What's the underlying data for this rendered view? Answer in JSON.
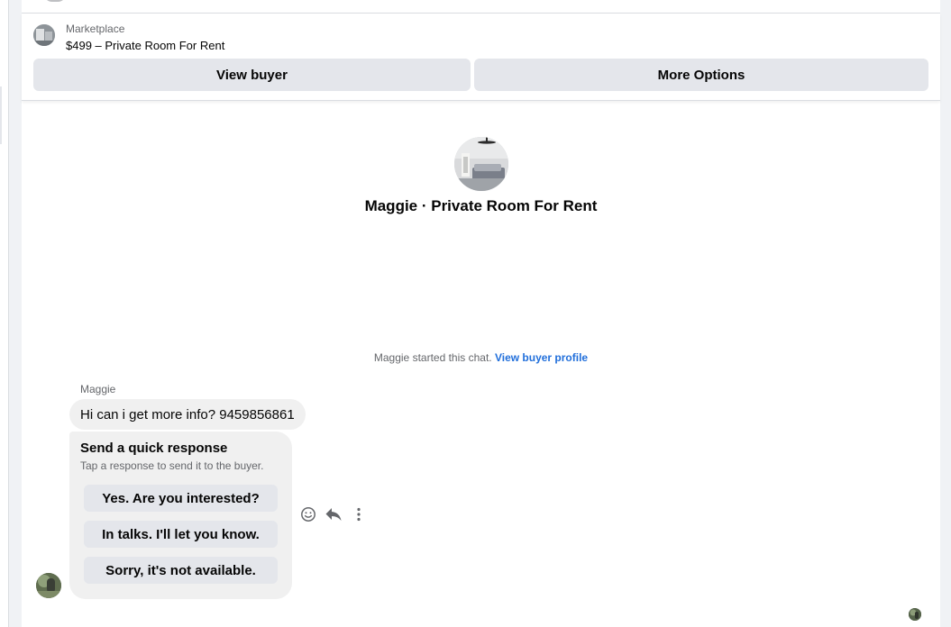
{
  "header": {
    "marketplace_label": "Marketplace",
    "listing_title": "$499 – Private Room For Rent",
    "view_buyer_label": "View buyer",
    "more_options_label": "More Options"
  },
  "conversation": {
    "title": "Maggie · Private Room For Rent",
    "started_text": "Maggie started this chat.",
    "view_profile_link": "View buyer profile"
  },
  "message": {
    "sender": "Maggie",
    "text": "Hi can i get more info? 9459856861"
  },
  "quick_response": {
    "title": "Send a quick response",
    "subtitle": "Tap a response to send it to the buyer.",
    "options": [
      "Yes. Are you interested?",
      "In talks. I'll let you know.",
      "Sorry, it's not available."
    ]
  },
  "message_actions": [
    "emoji-react-icon",
    "reply-icon",
    "more-vertical-icon"
  ],
  "colors": {
    "link": "#216fdb",
    "button_bg": "#e4e6eb",
    "bubble_bg": "#f0f0f0",
    "muted_text": "#65676b"
  }
}
